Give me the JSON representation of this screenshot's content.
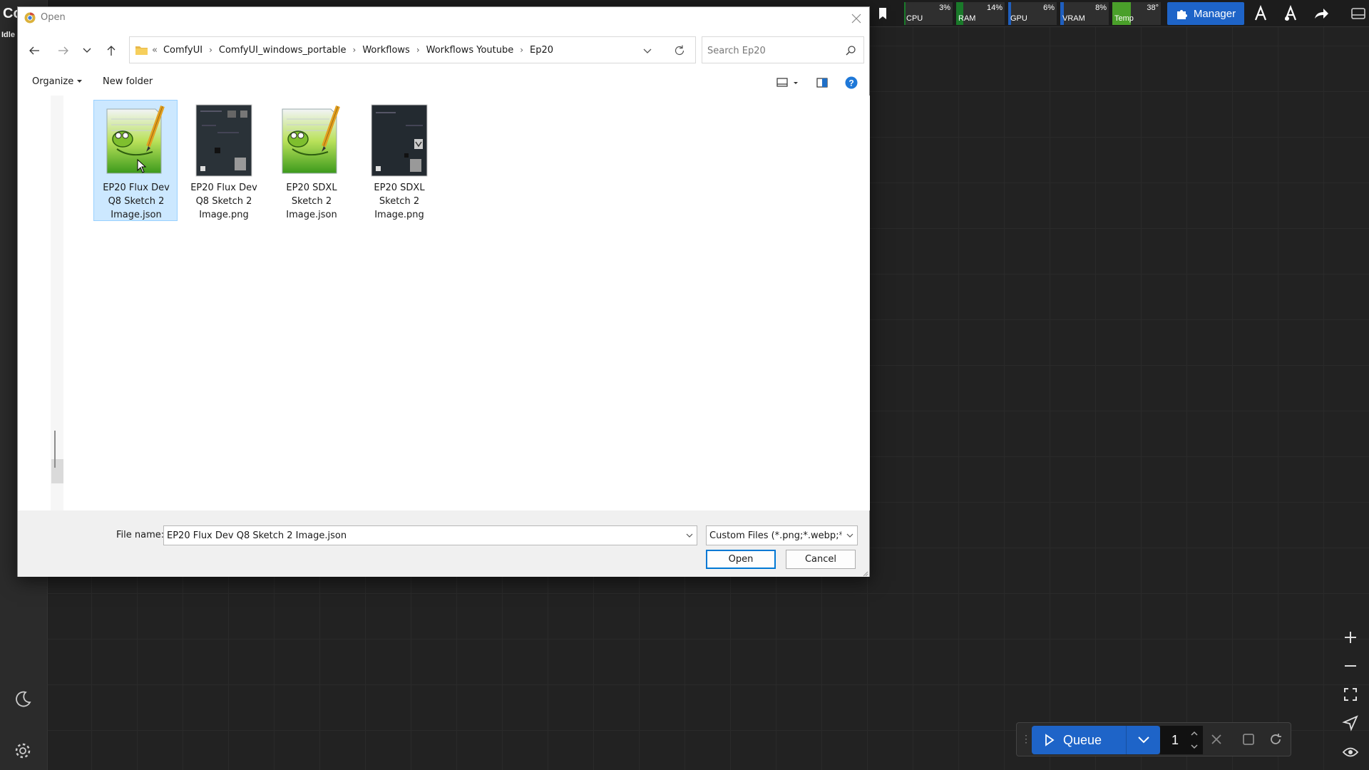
{
  "app": {
    "logo_text": "Co",
    "status": "Idle"
  },
  "monitor": [
    {
      "label": "CPU",
      "value": "3%",
      "color": "#1a7a2a",
      "level": 0.03
    },
    {
      "label": "RAM",
      "value": "14%",
      "color": "#1a7a2a",
      "level": 0.14
    },
    {
      "label": "GPU",
      "value": "6%",
      "color": "#1f5fbf",
      "level": 0.06
    },
    {
      "label": "VRAM",
      "value": "8%",
      "color": "#1f5fbf",
      "level": 0.08
    },
    {
      "label": "Temp",
      "value": "38°",
      "color": "#4aa02a",
      "level": 0.38
    }
  ],
  "manager": {
    "label": "Manager"
  },
  "queue": {
    "label": "Queue",
    "count": "1"
  },
  "dialog": {
    "title": "Open",
    "breadcrumb": [
      "ComfyUI",
      "ComfyUI_windows_portable",
      "Workflows",
      "Workflows Youtube",
      "Ep20"
    ],
    "breadcrumb_overflow": "«",
    "search_placeholder": "Search Ep20",
    "organize_label": "Organize",
    "new_folder_label": "New folder",
    "files": [
      {
        "line1": "EP20 Flux Dev",
        "line2": "Q8 Sketch 2",
        "line3": "Image.json",
        "type": "notepad",
        "selected": true
      },
      {
        "line1": "EP20 Flux Dev",
        "line2": "Q8 Sketch 2",
        "line3": "Image.png",
        "type": "image",
        "selected": false
      },
      {
        "line1": "EP20 SDXL",
        "line2": "Sketch 2",
        "line3": "Image.json",
        "type": "notepad",
        "selected": false
      },
      {
        "line1": "EP20 SDXL",
        "line2": "Sketch 2",
        "line3": "Image.png",
        "type": "image",
        "selected": false
      }
    ],
    "filename_label": "File name:",
    "filename_value": "EP20 Flux Dev Q8 Sketch 2 Image.json",
    "filetype_value": "Custom Files (*.png;*.webp;*.flac",
    "open_label": "Open",
    "cancel_label": "Cancel"
  }
}
